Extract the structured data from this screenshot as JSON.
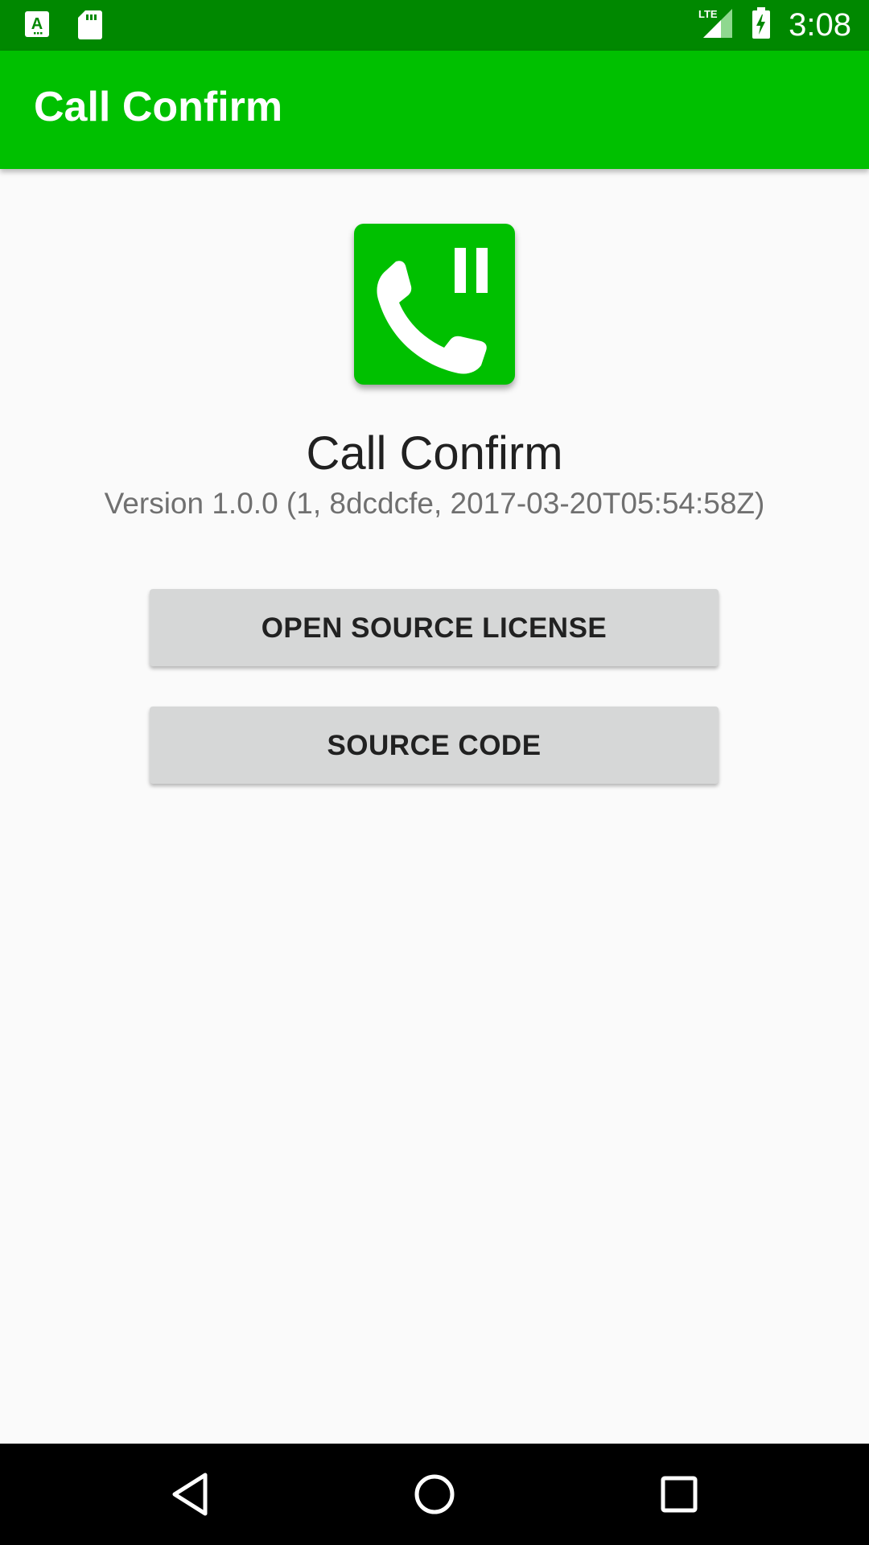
{
  "status_bar": {
    "time": "3:08",
    "left_icons": [
      "accessibility-a-icon",
      "sd-card-icon"
    ],
    "right_icons": [
      "lte-signal-icon",
      "battery-charging-icon"
    ],
    "network_label": "LTE"
  },
  "app_bar": {
    "title": "Call Confirm"
  },
  "about": {
    "icon": "phone-pause-app-icon",
    "app_name": "Call Confirm",
    "version": "Version 1.0.0 (1, 8dcdcfe, 2017-03-20T05:54:58Z)"
  },
  "buttons": {
    "open_source_license": "OPEN SOURCE LICENSE",
    "source_code": "SOURCE CODE"
  },
  "nav_bar": {
    "items": [
      "back-icon",
      "home-icon",
      "recents-icon"
    ]
  },
  "colors": {
    "status_bar": "#008800",
    "app_bar": "#00c000",
    "background": "#fafafa",
    "button": "#d6d7d7"
  }
}
